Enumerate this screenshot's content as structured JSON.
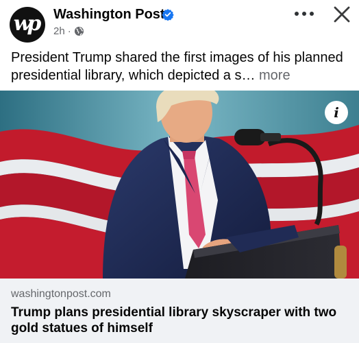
{
  "post": {
    "page_name": "Washington Post",
    "avatar_text": "wp",
    "timestamp": "2h",
    "separator": "·",
    "privacy_icon": "globe-icon",
    "verified_icon": "verified-badge-icon",
    "options_icon": "more-horizontal-icon",
    "close_icon": "close-icon",
    "text": "President Trump shared the first images of his planned presidential library, which depicted a s…",
    "see_more": " more"
  },
  "media": {
    "info_label": "i"
  },
  "link_preview": {
    "domain": "washingtonpost.com",
    "title": "Trump plans presidential library skyscraper with two gold statues of himself"
  },
  "colors": {
    "secondary_text": "#65676b",
    "verified_blue": "#1877f2",
    "link_card_bg": "#f0f2f5"
  }
}
